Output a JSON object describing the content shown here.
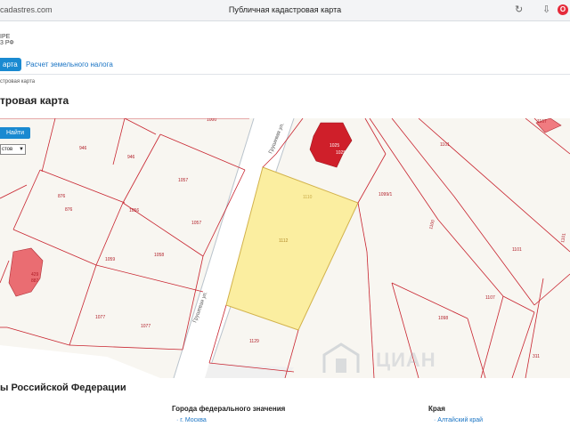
{
  "browser": {
    "url": "cadastres.com",
    "title": "Публичная кадастровая карта"
  },
  "site": {
    "name": "IPE",
    "subtitle": "3 РФ"
  },
  "tabs": [
    {
      "label": "арта",
      "active": true
    },
    {
      "label": "Расчет земельного налога",
      "active": false
    }
  ],
  "breadcrumb": "стровая карта",
  "page_title": "тровая карта",
  "map_controls": {
    "search_button": "Найти",
    "layer_select_value": "стов"
  },
  "parcels": {
    "top_edge": "1000",
    "p946a": "946",
    "p946b": "946",
    "p876a": "876",
    "p876b": "876",
    "p1056": "1056",
    "p1057a": "1057",
    "p1057b": "1057",
    "p1058": "1058",
    "p1059": "1059",
    "p887": "887",
    "p429": "429",
    "p1077a": "1077",
    "p1077b": "1077",
    "p1129": "1129",
    "p1110": "1110",
    "p1112": "1112",
    "p1099": "1099/1",
    "p1025a": "1025",
    "p1025b": "1025",
    "p1101a": "1101",
    "p1101b": "1101",
    "p1101c": "1101",
    "p1100": "1100",
    "p1107": "1107",
    "p1098": "1098",
    "p311": "311",
    "p1167": "1167"
  },
  "streets": [
    "Грушевая ул.",
    "Грушевая ул."
  ],
  "watermark": "ЦИАН",
  "regions": {
    "title": "ы Российской Федерации",
    "federal_cities_heading": "Города федерального значения",
    "federal_cities": [
      "г. Москва"
    ],
    "krai_heading": "Края",
    "krai": [
      "Алтайский край"
    ]
  },
  "colors": {
    "accent": "#1a8ad1",
    "parcel_border": "#c8242f",
    "selected_parcel_fill": "#fbeea0",
    "building": "#cf1f2a",
    "link": "#1a74c4"
  }
}
